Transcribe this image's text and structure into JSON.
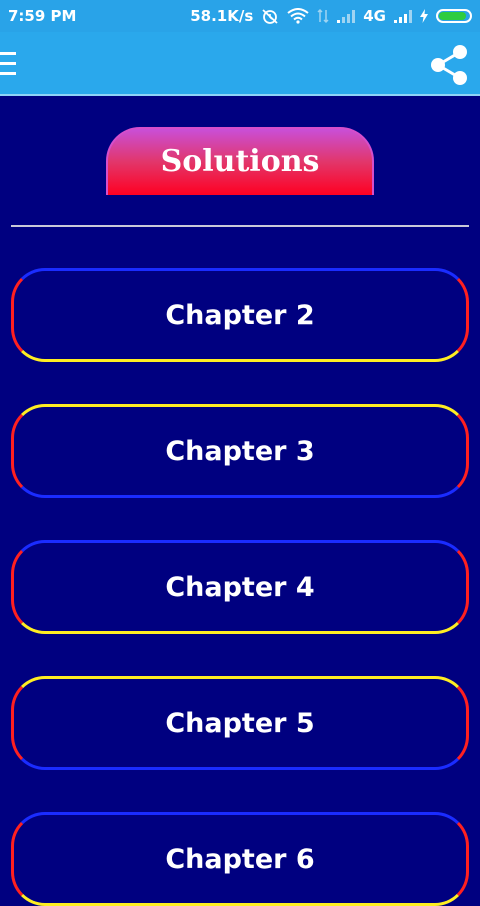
{
  "status_bar": {
    "time": "7:59 PM",
    "speed": "58.1K/s",
    "network": "4G",
    "battery_level": 0.9,
    "colors": {
      "background": "#29a3e8",
      "battery": "#2ecc40"
    }
  },
  "toolbar": {
    "menu_icon": "hamburger-menu-icon",
    "share_icon": "share-icon",
    "background": "#2aa8ec"
  },
  "banner": {
    "title": "Solutions"
  },
  "chapters": [
    {
      "label": "Chapter 2"
    },
    {
      "label": "Chapter 3"
    },
    {
      "label": "Chapter 4"
    },
    {
      "label": "Chapter 5"
    },
    {
      "label": "Chapter 6"
    }
  ],
  "theme": {
    "page_background": "#000080",
    "accent_blue": "#1a2cff",
    "accent_red": "#ff2020",
    "accent_yellow": "#ffee22"
  }
}
